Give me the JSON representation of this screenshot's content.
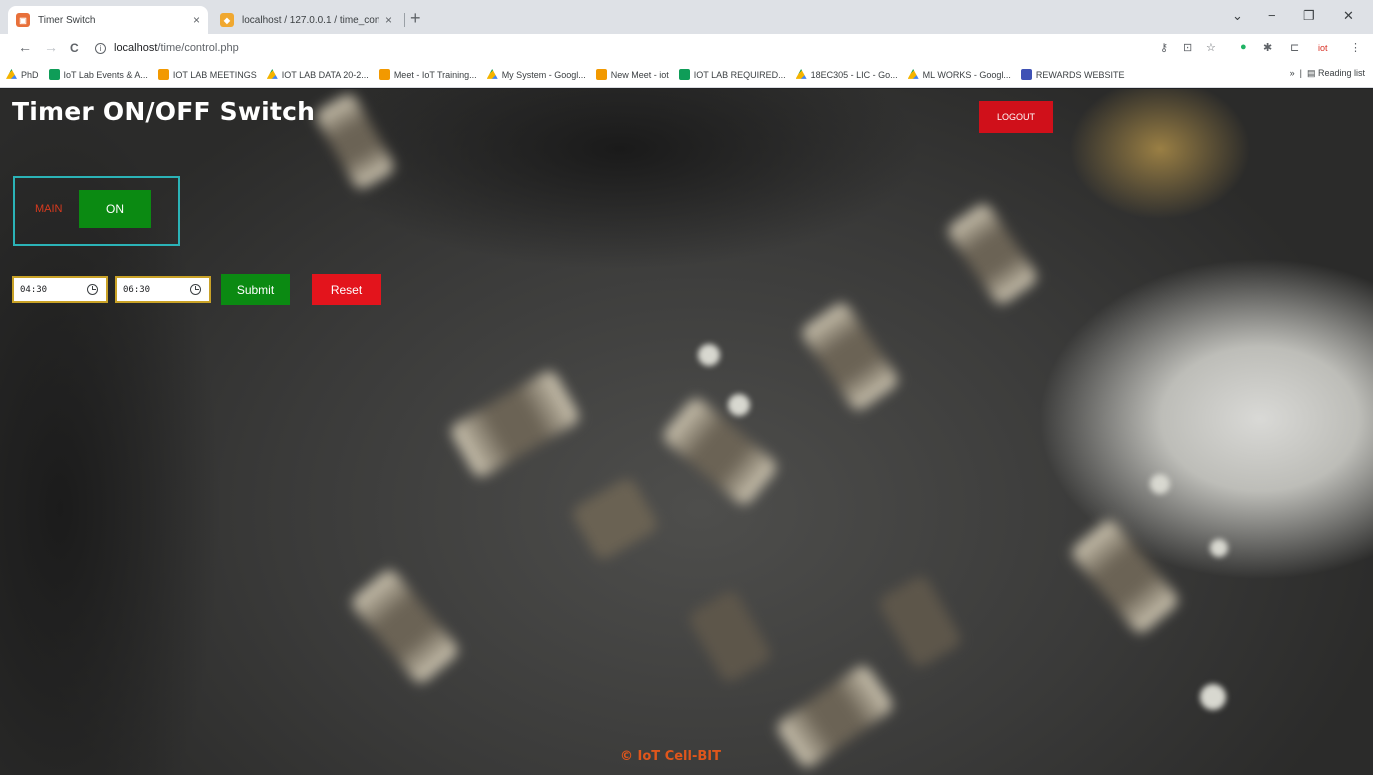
{
  "browser": {
    "tabs": [
      {
        "title": "Timer Switch",
        "active": true
      },
      {
        "title": "localhost / 127.0.0.1 / time_contr",
        "active": false
      }
    ],
    "new_tab": "+",
    "close": "×",
    "window_controls": {
      "chevron": "⌄",
      "minimize": "−",
      "maximize": "❐",
      "close": "✕"
    },
    "nav": {
      "back": "←",
      "forward": "→",
      "reload": "C"
    },
    "url_host": "localhost",
    "url_path": "/time/control.php",
    "bookmarks": [
      {
        "label": "PhD",
        "icon": "drive"
      },
      {
        "label": "IoT Lab Events & A...",
        "icon": "sheet"
      },
      {
        "label": "IOT LAB MEETINGS",
        "icon": "meet"
      },
      {
        "label": "IOT LAB DATA 20-2...",
        "icon": "drive"
      },
      {
        "label": "Meet - IoT Training...",
        "icon": "meet"
      },
      {
        "label": "My System - Googl...",
        "icon": "drive"
      },
      {
        "label": "New Meet - iot",
        "icon": "meet"
      },
      {
        "label": "IOT LAB REQUIRED...",
        "icon": "sheet"
      },
      {
        "label": "18EC305 - LIC - Go...",
        "icon": "drive"
      },
      {
        "label": "ML WORKS - Googl...",
        "icon": "drive"
      },
      {
        "label": "REWARDS WEBSITE",
        "icon": "rew"
      }
    ],
    "more_bookmarks": "»",
    "reading_list": "Reading list"
  },
  "page": {
    "title": "Timer ON/OFF Switch",
    "logout_label": "LOGOUT",
    "main_label": "MAIN",
    "main_state": "ON",
    "time_on": "04:30",
    "time_off": "06:30",
    "submit_label": "Submit",
    "reset_label": "Reset",
    "footer": "© IoT Cell-BIT"
  },
  "colors": {
    "accent_green": "#0b8a12",
    "accent_red": "#e3141c",
    "box_border": "#2bb3b7",
    "footer": "#e0561b"
  }
}
